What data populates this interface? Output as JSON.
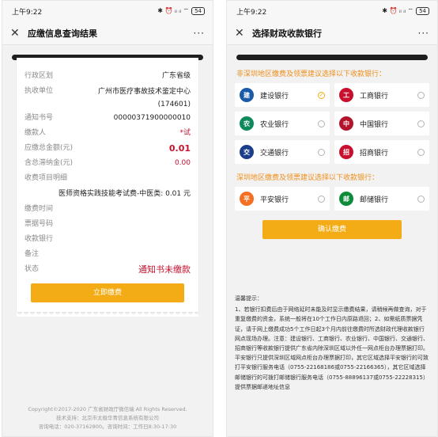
{
  "left": {
    "status": {
      "time": "上午9:22",
      "signal": "✱ ⏰ ᵢₗ ᵢₗ ⌔",
      "battery": "54"
    },
    "nav": {
      "close": "✕",
      "title": "应缴信息查询结果",
      "more": "···"
    },
    "fields": {
      "region_label": "行政区划",
      "region_value": "广东省级",
      "unit_label": "执收单位",
      "unit_value": "广州市医疗事故技术鉴定中心(174601)",
      "notice_label": "通知书号",
      "notice_value": "00000371900000010",
      "payer_label": "缴款人",
      "payer_value": "*试",
      "total_label": "应缴总金额(元)",
      "total_value": "0.01",
      "late_label": "含总滞纳金(元)",
      "late_value": "0.00",
      "items_label": "收费项目明细",
      "item_line": "医师资格实践技能考试费-中医类: 0.01 元",
      "paytime_label": "缴费时间",
      "receipt_label": "票据号码",
      "bank_label": "收款银行",
      "remark_label": "备注",
      "state_label": "状态",
      "state_value": "通知书未缴款"
    },
    "pay_button": "立即缴费",
    "footer": {
      "line1": "Copyright©2017-2020 广东省财政厅微信端 All Rights Reserved.",
      "line2": "技术支持：北京市太极华青信息系统有限公司",
      "line3": "咨询电话：020-37162800。咨询时间：工作日8:30-17:30"
    }
  },
  "right": {
    "status": {
      "time": "上午9:22",
      "signal": "✱ ⏰ ᵢₗ ᵢₗ ⌔",
      "battery": "54"
    },
    "nav": {
      "close": "✕",
      "title": "选择财政收款银行",
      "more": "···"
    },
    "section1_title": "非深圳地区缴费及领票建议选择以下收款银行：",
    "banks1": [
      {
        "name": "建设银行",
        "logo": "建",
        "color": "#1a5aa8",
        "icon": "ccb-logo-icon",
        "checked": true
      },
      {
        "name": "工商银行",
        "logo": "工",
        "color": "#c8102e",
        "icon": "icbc-logo-icon",
        "checked": false
      },
      {
        "name": "农业银行",
        "logo": "农",
        "color": "#0d8a5c",
        "icon": "abc-logo-icon",
        "checked": false
      },
      {
        "name": "中国银行",
        "logo": "中",
        "color": "#b4142a",
        "icon": "boc-logo-icon",
        "checked": false
      },
      {
        "name": "交通银行",
        "logo": "交",
        "color": "#1b3f8b",
        "icon": "bocom-logo-icon",
        "checked": false
      },
      {
        "name": "招商银行",
        "logo": "招",
        "color": "#c8102e",
        "icon": "cmb-logo-icon",
        "checked": false
      }
    ],
    "section2_title": "深圳地区缴费及领票建议选择以下收款银行：",
    "banks2": [
      {
        "name": "平安银行",
        "logo": "平",
        "color": "#f36f21",
        "icon": "pingan-logo-icon",
        "checked": false
      },
      {
        "name": "邮储银行",
        "logo": "邮",
        "color": "#0e8a3b",
        "icon": "psbc-logo-icon",
        "checked": false
      }
    ],
    "confirm_button": "确认缴费",
    "tips_title": "温馨提示：",
    "tips_body": "1、若银行扣费后由于网络延时未能及时显示缴费结果，请稍候再做查询，对于重复缴费的资金，系统一般将在10个工作日内原路退回；2、如需纸质票据凭证，请于网上缴费成功5个工作日起3个月内前往缴费时所选财政代理收款银行网点现场办理。注意：建设银行、工商银行、农业银行、中国银行、交通银行、招商银行等收款银行提供广东省内除深圳区域以外任一网点柜台办理票据打印。平安银行只提供深圳区域网点柜台办理票据打印，其它区域选择平安银行的可致打平安银行服务电话（0755-22168186或0755-22166365），其它区域选择邮储银行的可拨打邮储银行服务电话（0755-88896137或0755-22228315）提供票据邮递地址信息"
  }
}
